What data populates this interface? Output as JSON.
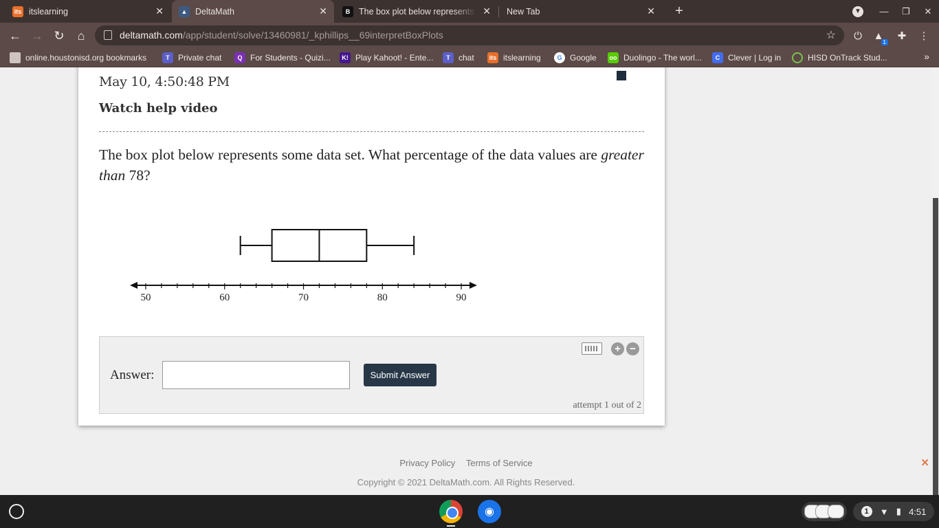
{
  "tabs": [
    {
      "title": "itslearning",
      "icon": "itslearning-icon",
      "active": false
    },
    {
      "title": "DeltaMath",
      "icon": "graduation-cap-icon",
      "active": true
    },
    {
      "title": "The box plot below represents so",
      "icon": "brainly-icon",
      "active": false
    },
    {
      "title": "New Tab",
      "icon": "",
      "active": false
    }
  ],
  "toolbar": {
    "url_host": "deltamath.com",
    "url_path": "/app/student/solve/13460981/_kphillips__69interpretBoxPlots",
    "extension_badge": "1"
  },
  "bookmarks": [
    {
      "label": "online.houstonisd.org bookmarks",
      "icon": "folder-icon"
    },
    {
      "label": "Private chat",
      "icon": "teams-icon"
    },
    {
      "label": "For Students - Quizi...",
      "icon": "quizizz-icon"
    },
    {
      "label": "Play Kahoot! - Ente...",
      "icon": "kahoot-icon"
    },
    {
      "label": "chat",
      "icon": "teams-icon"
    },
    {
      "label": "itslearning",
      "icon": "itslearning-icon"
    },
    {
      "label": "Google",
      "icon": "google-icon"
    },
    {
      "label": "Duolingo - The worl...",
      "icon": "duolingo-icon"
    },
    {
      "label": "Clever | Log in",
      "icon": "clever-icon"
    },
    {
      "label": "HISD OnTrack Stud...",
      "icon": "ontrack-icon"
    }
  ],
  "problem": {
    "timestamp": "May 10, 4:50:48 PM",
    "help_link": "Watch help video",
    "question_part1": "The box plot below represents some data set. What percentage of the data values are",
    "question_emphasis": "greater than",
    "question_part2": "78?"
  },
  "chart_data": {
    "type": "box",
    "min": 62,
    "q1": 66,
    "median": 72,
    "q3": 78,
    "max": 84,
    "axis": {
      "range": [
        48,
        92
      ],
      "major_ticks": [
        50,
        60,
        70,
        80,
        90
      ],
      "minor_step": 2
    },
    "tick_labels": [
      "50",
      "60",
      "70",
      "80",
      "90"
    ]
  },
  "answer": {
    "label": "Answer:",
    "value": "",
    "submit_label": "Submit Answer",
    "attempt_text": "attempt 1 out of 2"
  },
  "footer": {
    "privacy": "Privacy Policy",
    "terms": "Terms of Service",
    "copyright": "Copyright © 2021 DeltaMath.com. All Rights Reserved."
  },
  "shelf": {
    "notification_count": "1",
    "time": "4:51"
  },
  "colors": {
    "submit_button": "#283748",
    "browser_frame": "#3c3230",
    "toolbar": "#5b4a47"
  }
}
